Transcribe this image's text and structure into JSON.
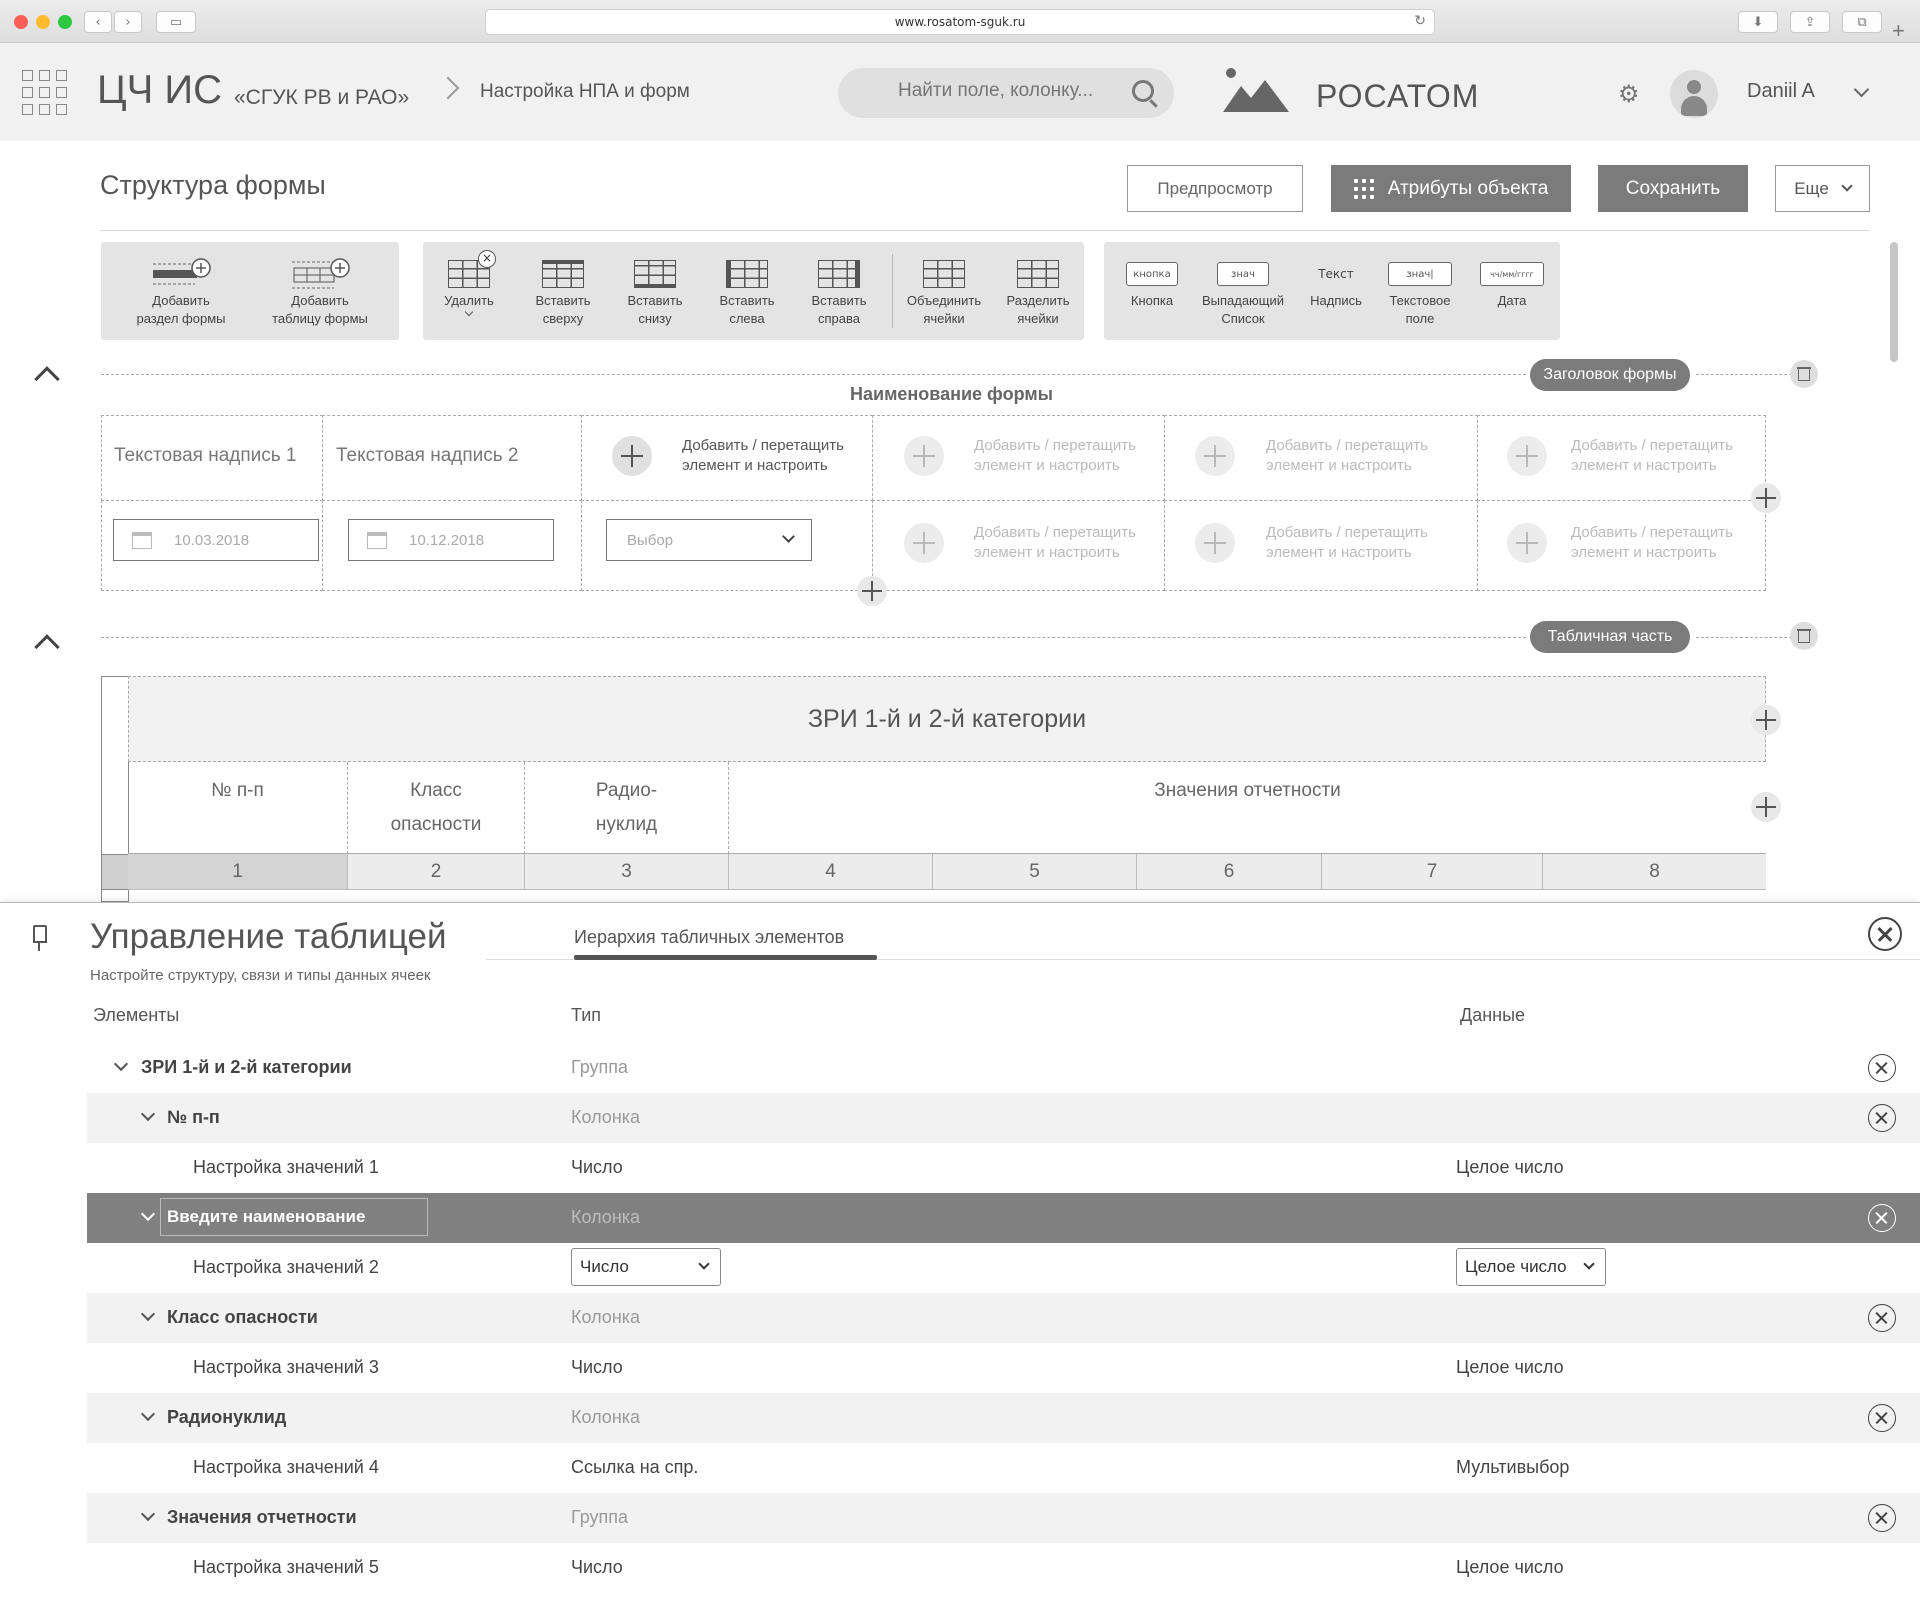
{
  "browser": {
    "url": "www.rosatom-sguk.ru"
  },
  "app": {
    "brand": "ЦЧ ИС",
    "brand_sub": "«СГУК РВ и РАО»",
    "breadcrumb": "Настройка НПА и форм",
    "search_placeholder": "Найти поле, колонку...",
    "logo_text": "РОСАТОМ",
    "user_name": "Daniil A"
  },
  "page": {
    "title": "Структура формы",
    "buttons": {
      "preview": "Предпросмотр",
      "attributes": "Атрибуты объекта",
      "save": "Сохранить",
      "more": "Еще"
    }
  },
  "toolbar": {
    "group1": [
      {
        "label": "Добавить\nраздел формы"
      },
      {
        "label": "Добавить\nтаблицу формы"
      }
    ],
    "group2": [
      {
        "label": "Удалить"
      },
      {
        "label": "Вставить\nсверху"
      },
      {
        "label": "Вставить\nснизу"
      },
      {
        "label": "Вставить\nслева"
      },
      {
        "label": "Вставить\nсправа"
      },
      {
        "label": "Объединить\nячейки"
      },
      {
        "label": "Разделить\nячейки"
      }
    ],
    "group3": [
      {
        "label": "Кнопка",
        "preview": "кнопка"
      },
      {
        "label": "Выпадающий\nСписок",
        "preview": "знач"
      },
      {
        "label": "Надпись",
        "preview": "Текст"
      },
      {
        "label": "Текстовое\nполе",
        "preview": "знач|"
      },
      {
        "label": "Дата",
        "preview": "чч/мм/гггг"
      }
    ]
  },
  "form_header": {
    "pill": "Заголовок формы",
    "title": "Наименование формы",
    "text1": "Текстовая надпись 1",
    "text2": "Текстовая надпись 2",
    "add_hint": "Добавить / перетащить\nэлемент и настроить",
    "date1": "10.03.2018",
    "date2": "10.12.2018",
    "select_placeholder": "Выбор"
  },
  "table_part": {
    "pill": "Табличная часть",
    "title": "ЗРИ 1-й и 2-й категории",
    "headers": [
      "№ п-п",
      "Класс\nопасности",
      "Радио-\nнуклид",
      "Значения отчетности"
    ],
    "numbers": [
      "1",
      "2",
      "3",
      "4",
      "5",
      "6",
      "7",
      "8"
    ]
  },
  "panel": {
    "title": "Управление таблицей",
    "subtitle": "Настройте структуру, связи и типы данных ячеек",
    "tab": "Иерархия табличных элементов",
    "col_elements": "Элементы",
    "col_type": "Тип",
    "col_data": "Данные",
    "rows": [
      {
        "name": "ЗРИ 1-й и 2-й категории",
        "type": "Группа",
        "data": ""
      },
      {
        "name": "№ п-п",
        "type": "Колонка",
        "data": ""
      },
      {
        "name": "Настройка значений 1",
        "type": "Число",
        "data": "Целое число"
      },
      {
        "name": "Введите наименование",
        "type": "Колонка",
        "data": ""
      },
      {
        "name": "Настройка значений 2",
        "type": "Число",
        "data": "Целое число"
      },
      {
        "name": "Класс опасности",
        "type": "Колонка",
        "data": ""
      },
      {
        "name": "Настройка значений 3",
        "type": "Число",
        "data": "Целое число"
      },
      {
        "name": "Радионуклид",
        "type": "Колонка",
        "data": ""
      },
      {
        "name": "Настройка значений 4",
        "type": "Ссылка на спр.",
        "data": "Мультивыбор"
      },
      {
        "name": "Значения отчетности",
        "type": "Группа",
        "data": ""
      },
      {
        "name": "Настройка значений 5",
        "type": "Число",
        "data": "Целое число"
      }
    ]
  }
}
